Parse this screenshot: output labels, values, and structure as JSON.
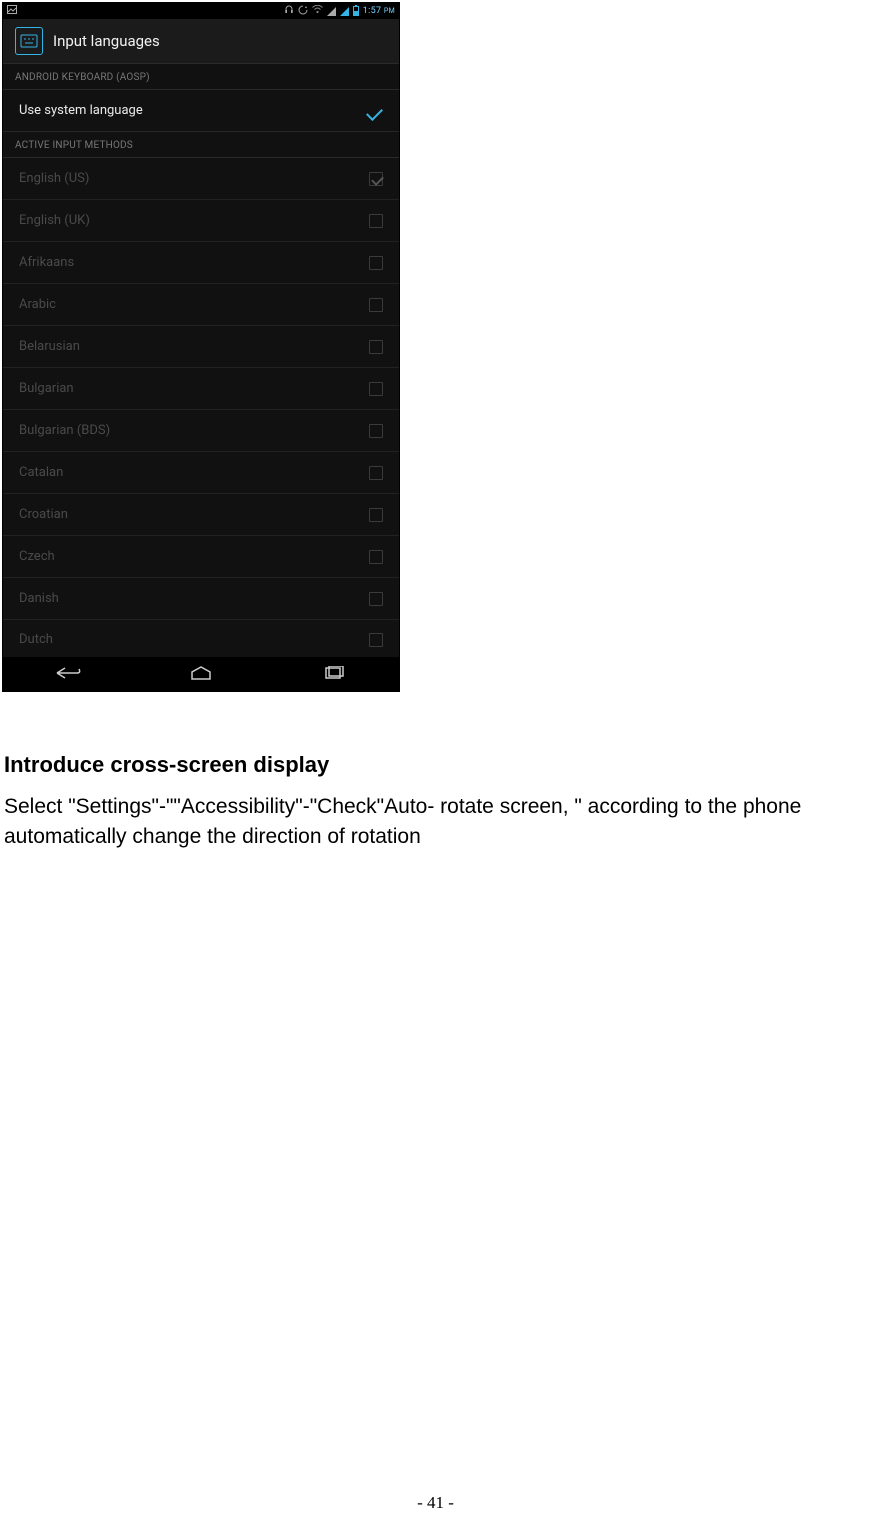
{
  "status": {
    "time": "1:57",
    "ampm": "PM"
  },
  "header": {
    "title": "Input languages"
  },
  "section1": {
    "title": "ANDROID KEYBOARD (AOSP)"
  },
  "useSystem": {
    "label": "Use system language"
  },
  "section2": {
    "title": "ACTIVE INPUT METHODS"
  },
  "langs": [
    {
      "label": "English (US)",
      "checked": true
    },
    {
      "label": "English (UK)",
      "checked": false
    },
    {
      "label": "Afrikaans",
      "checked": false
    },
    {
      "label": "Arabic",
      "checked": false
    },
    {
      "label": "Belarusian",
      "checked": false
    },
    {
      "label": "Bulgarian",
      "checked": false
    },
    {
      "label": "Bulgarian (BDS)",
      "checked": false
    },
    {
      "label": "Catalan",
      "checked": false
    },
    {
      "label": "Croatian",
      "checked": false
    },
    {
      "label": "Czech",
      "checked": false
    },
    {
      "label": "Danish",
      "checked": false
    },
    {
      "label": "Dutch",
      "checked": false
    }
  ],
  "doc": {
    "heading": "Introduce cross-screen display",
    "body": "Select \"Settings\"-\"\"Accessibility\"-\"Check\"Auto- rotate screen, \" according to the phone automatically change the direction of rotation"
  },
  "pagenum": "- 41 -"
}
